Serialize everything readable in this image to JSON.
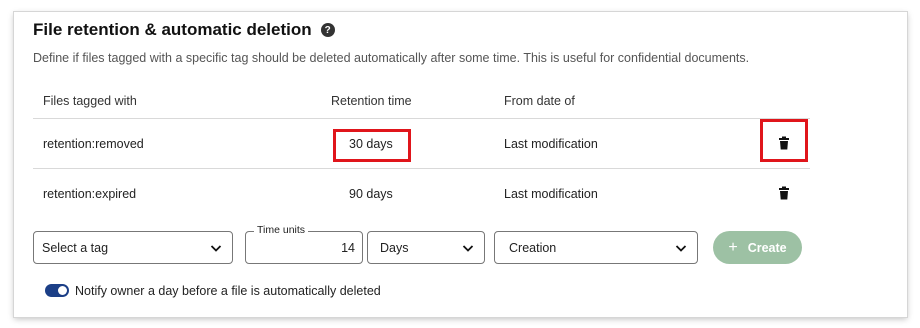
{
  "section": {
    "title": "File retention & automatic deletion",
    "description": "Define if files tagged with a specific tag should be deleted automatically after some time. This is useful for confidential documents."
  },
  "table": {
    "headers": [
      "Files tagged with",
      "Retention time",
      "From date of"
    ],
    "rows": [
      {
        "tag": "retention:removed",
        "retention": "30 days",
        "from": "Last modification"
      },
      {
        "tag": "retention:expired",
        "retention": "90 days",
        "from": "Last modification"
      }
    ]
  },
  "form": {
    "tag_select": "Select a tag",
    "time_units_label": "Time units",
    "time_units_value": "14",
    "unit_select": "Days",
    "date_select": "Creation",
    "create_label": "Create"
  },
  "notify": {
    "label": "Notify owner a day before a file is automatically deleted",
    "enabled": true
  },
  "colors": {
    "accent": "#1c3f87",
    "create_disabled": "#9dc1a4",
    "highlight": "#e0151b"
  },
  "icons": {
    "help": "question-circle-icon",
    "delete": "trash-icon",
    "dropdown": "chevron-down-icon",
    "add": "plus-icon"
  }
}
